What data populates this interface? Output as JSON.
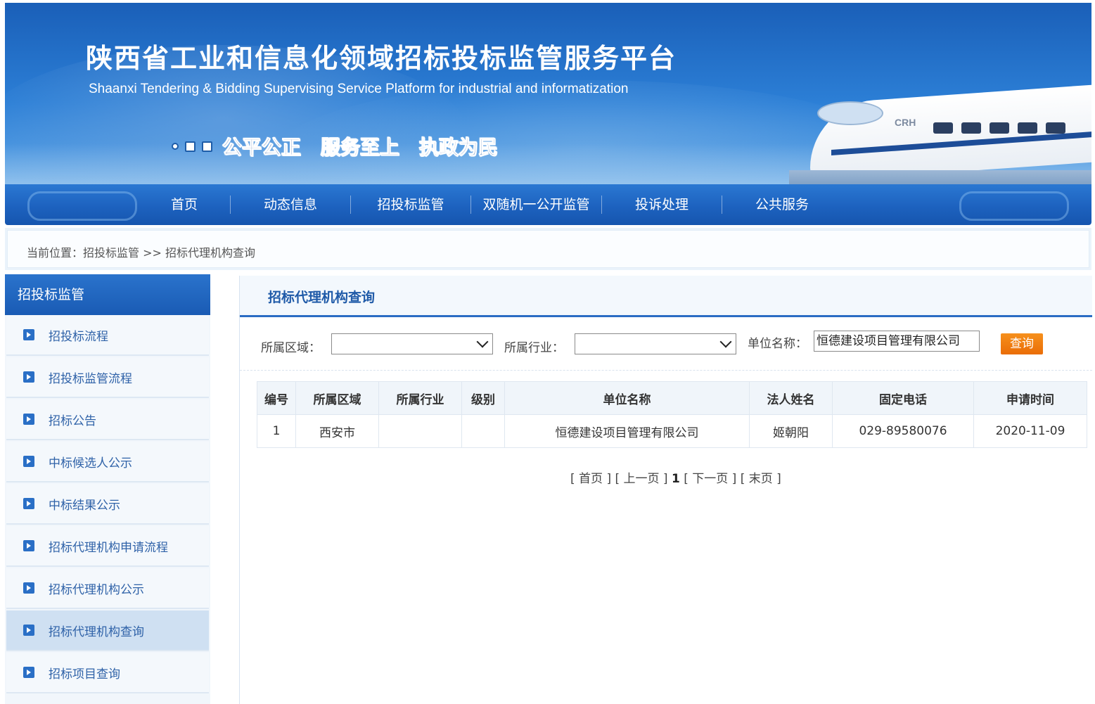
{
  "banner": {
    "title_cn": "陕西省工业和信息化领域招标投标监管服务平台",
    "title_en": "Shaanxi Tendering & Bidding Supervising Service Platform for industrial and informatization",
    "slogans": [
      "公平公正",
      "服务至上",
      "执政为民"
    ],
    "train_badge": "CRH"
  },
  "nav": {
    "items": [
      "首页",
      "动态信息",
      "招投标监管",
      "双随机一公开监管",
      "投诉处理",
      "公共服务"
    ]
  },
  "breadcrumb": {
    "text": "当前位置：招投标监管 >> 招标代理机构查询"
  },
  "sidebar": {
    "title": "招投标监管",
    "items": [
      {
        "label": "招投标流程"
      },
      {
        "label": "招投标监管流程"
      },
      {
        "label": "招标公告"
      },
      {
        "label": "中标候选人公示"
      },
      {
        "label": "中标结果公示"
      },
      {
        "label": "招标代理机构申请流程"
      },
      {
        "label": "招标代理机构公示"
      },
      {
        "label": "招标代理机构查询"
      },
      {
        "label": "招标项目查询"
      }
    ],
    "active_index": 7
  },
  "main": {
    "title": "招标代理机构查询",
    "search": {
      "region_label": "所属区域：",
      "region_value": "",
      "industry_label": "所属行业：",
      "industry_value": "",
      "name_label": "单位名称：",
      "name_value": "恒德建设项目管理有限公司",
      "button": "查询"
    },
    "table": {
      "headers": [
        "编号",
        "所属区域",
        "所属行业",
        "级别",
        "单位名称",
        "法人姓名",
        "固定电话",
        "申请时间"
      ],
      "rows": [
        [
          "1",
          "西安市",
          "",
          "",
          "恒德建设项目管理有限公司",
          "姬朝阳",
          "029-89580076",
          "2020-11-09"
        ]
      ]
    },
    "pager": {
      "first": "[ 首页 ]",
      "prev": "[ 上一页 ]",
      "current": "1",
      "next": "[ 下一页 ]",
      "last": "[ 末页 ]"
    }
  },
  "colors": {
    "nav_blue": "#1d62bf",
    "accent_orange": "#ea6d07",
    "link_blue": "#2f62a8"
  }
}
